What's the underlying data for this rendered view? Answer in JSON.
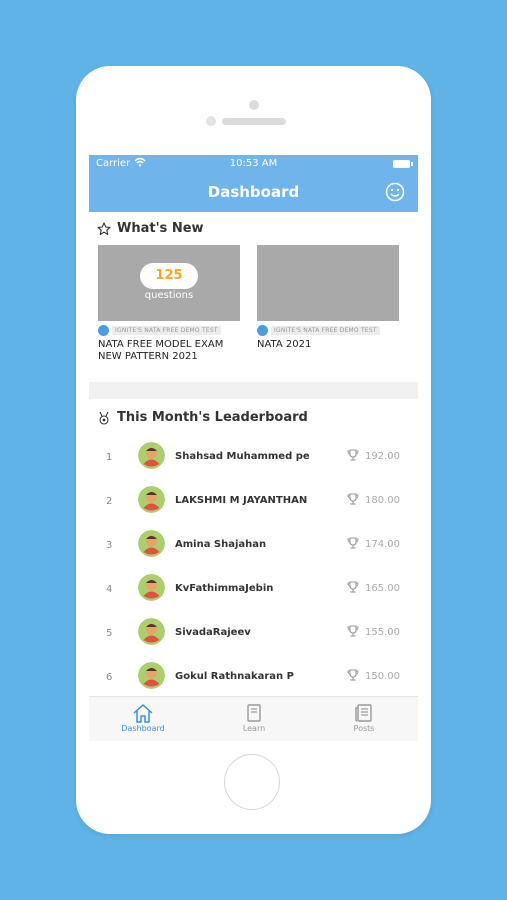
{
  "status_bar": {
    "carrier": "Carrier",
    "time": "10:53 AM"
  },
  "header": {
    "title": "Dashboard"
  },
  "whats_new": {
    "heading": "What's New",
    "cards": [
      {
        "count": "125",
        "count_label": "questions",
        "tag": "IGNITE'S NATA FREE DEMO TEST",
        "title": "NATA FREE MODEL EXAM NEW PATTERN 2021"
      },
      {
        "count": "",
        "count_label": "",
        "tag": "IGNITE'S NATA FREE DEMO TEST",
        "title": "NATA 2021"
      }
    ]
  },
  "leaderboard": {
    "heading": "This Month's Leaderboard",
    "rows": [
      {
        "rank": "1",
        "name": "Shahsad Muhammed pe",
        "score": "192.00"
      },
      {
        "rank": "2",
        "name": "LAKSHMI M JAYANTHAN",
        "score": "180.00"
      },
      {
        "rank": "3",
        "name": "Amina Shajahan",
        "score": "174.00"
      },
      {
        "rank": "4",
        "name": "KvFathimmaJebin",
        "score": "165.00"
      },
      {
        "rank": "5",
        "name": "SivadaRajeev",
        "score": "155.00"
      },
      {
        "rank": "6",
        "name": "Gokul Rathnakaran P",
        "score": "150.00"
      }
    ]
  },
  "tabs": [
    {
      "label": "Dashboard",
      "icon": "home-icon",
      "active": true
    },
    {
      "label": "Learn",
      "icon": "book-icon",
      "active": false
    },
    {
      "label": "Posts",
      "icon": "posts-icon",
      "active": false
    }
  ],
  "colors": {
    "background": "#5fb3e6",
    "appbar": "#6fb4ea",
    "accent": "#3a8ee6",
    "avatar": "#a9cf6f",
    "count": "#f5a623"
  }
}
